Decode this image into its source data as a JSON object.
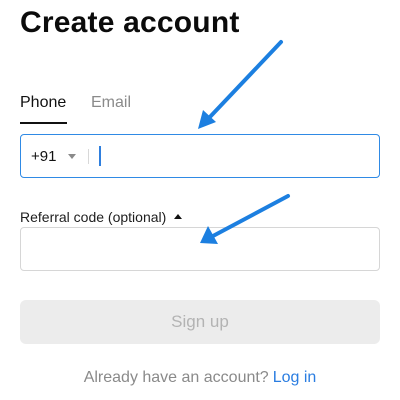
{
  "page": {
    "title": "Create account"
  },
  "tabs": [
    {
      "label": "Phone",
      "active": true
    },
    {
      "label": "Email",
      "active": false
    }
  ],
  "phone": {
    "country_code": "+91",
    "value": "",
    "placeholder": ""
  },
  "referral": {
    "label": "Referral code (optional)",
    "value": "",
    "placeholder": ""
  },
  "signup": {
    "label": "Sign up",
    "enabled": false
  },
  "login": {
    "prompt": "Already have an account?",
    "link_label": "Log in"
  },
  "colors": {
    "accent": "#2a7de1",
    "field_focus_border": "#2f8ae5",
    "disabled_button": "#ececec",
    "annotation_arrow": "#1c7fe0"
  },
  "icons": {
    "country_dropdown": "chevron-down-icon",
    "referral_toggle": "chevron-up-icon",
    "annotation": "arrow-icon"
  }
}
